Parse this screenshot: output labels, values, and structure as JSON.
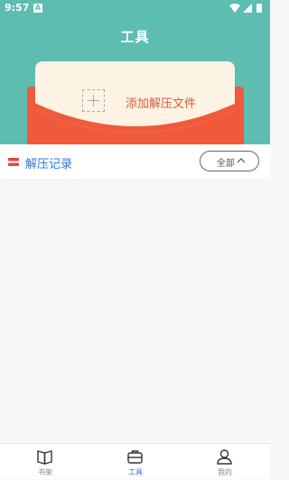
{
  "status_bar": {
    "time": "9:57",
    "notification_icon": "a-icon"
  },
  "header": {
    "title": "工具"
  },
  "add_card": {
    "label": "添加解压文件",
    "icon": "plus-icon"
  },
  "records": {
    "title": "解压记录",
    "filter_label": "全部"
  },
  "tabbar": {
    "items": [
      {
        "label": "书架",
        "icon": "book-icon",
        "active": false
      },
      {
        "label": "工具",
        "icon": "toolbox-icon",
        "active": true
      },
      {
        "label": "我的",
        "icon": "person-icon",
        "active": false
      }
    ]
  },
  "colors": {
    "header_bg": "#5cbdb0",
    "envelope": "#f05a3a",
    "card": "#fcf3e4",
    "accent_blue": "#2f74d8",
    "add_label": "#dd5a35"
  }
}
